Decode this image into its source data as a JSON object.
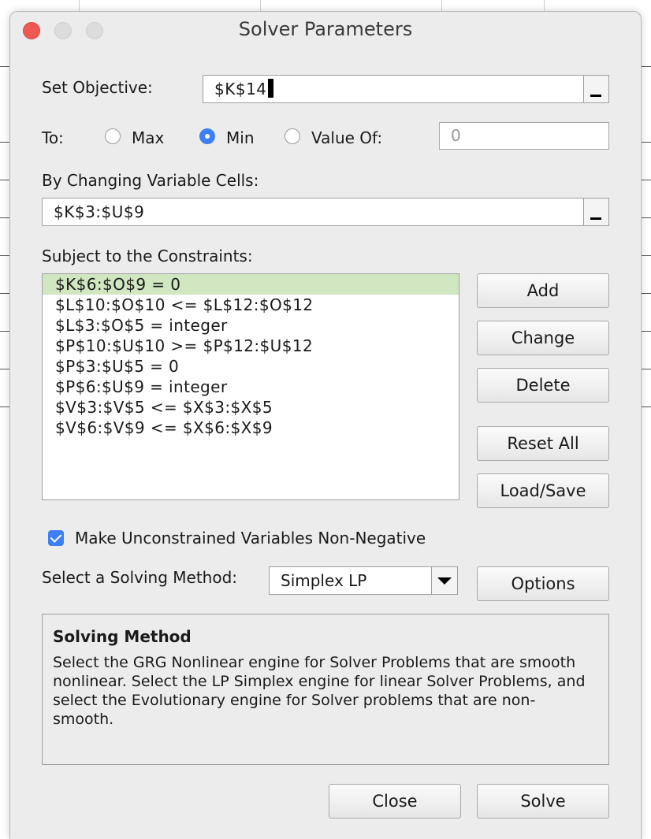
{
  "window": {
    "title": "Solver Parameters"
  },
  "objective": {
    "label": "Set Objective:",
    "value": "$K$14"
  },
  "to": {
    "label": "To:",
    "options": [
      "Max",
      "Min",
      "Value Of:"
    ],
    "selected": "Min",
    "value_of": "0"
  },
  "changing": {
    "label": "By Changing Variable Cells:",
    "value": "$K$3:$U$9"
  },
  "constraints": {
    "label": "Subject to the Constraints:",
    "items": [
      "$K$6:$O$9 = 0",
      "$L$10:$O$10 <= $L$12:$O$12",
      "$L$3:$O$5 = integer",
      "$P$10:$U$10 >= $P$12:$U$12",
      "$P$3:$U$5 = 0",
      "$P$6:$U$9 = integer",
      "$V$3:$V$5 <= $X$3:$X$5",
      "$V$6:$V$9 <= $X$6:$X$9"
    ],
    "selected_index": 0
  },
  "buttons": {
    "add": "Add",
    "change": "Change",
    "delete": "Delete",
    "reset_all": "Reset All",
    "load_save": "Load/Save",
    "options": "Options",
    "close": "Close",
    "solve": "Solve"
  },
  "nonneg": {
    "label": "Make Unconstrained Variables Non-Negative",
    "checked": true
  },
  "method": {
    "label": "Select a Solving Method:",
    "value": "Simplex LP"
  },
  "info": {
    "title": "Solving Method",
    "text": "Select the GRG Nonlinear engine for Solver Problems that are smooth nonlinear. Select the LP Simplex engine for linear Solver Problems, and select the Evolutionary engine for Solver problems that are non-smooth."
  },
  "colors": {
    "accent": "#3d7ff6",
    "selection": "#d0e7c1",
    "close_button": "#ee5a52"
  }
}
